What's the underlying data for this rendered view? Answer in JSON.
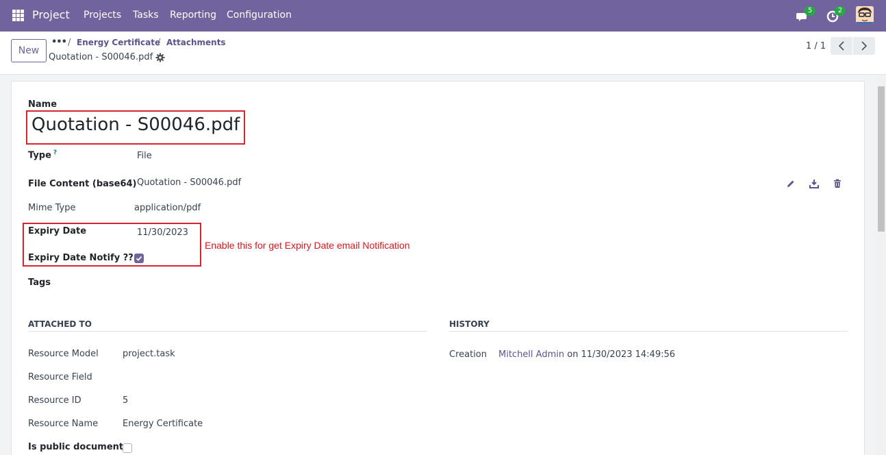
{
  "navbar": {
    "app_name": "Project",
    "menu": [
      "Projects",
      "Tasks",
      "Reporting",
      "Configuration"
    ],
    "messages_count": "5",
    "activities_count": "2",
    "bg_color": "#71639e"
  },
  "control_panel": {
    "new_label": "New",
    "breadcrumb": [
      "Energy Certificate",
      "Attachments"
    ],
    "record_title": "Quotation - S00046.pdf",
    "pager": "1 / 1"
  },
  "form": {
    "name_label": "Name",
    "name_value": "Quotation - S00046.pdf",
    "type_label": "Type",
    "type_help": "?",
    "type_value": "File",
    "file_content_label": "File Content (base64)",
    "file_content_value": "Quotation - S00046.pdf",
    "mime_label": "Mime Type",
    "mime_value": "application/pdf",
    "expiry_label": "Expiry Date",
    "expiry_value": "11/30/2023",
    "expiry_notify_label": "Expiry Date Notify ??",
    "expiry_notify_checked": true,
    "tags_label": "Tags",
    "annotation": "Enable this for get Expiry Date email Notification"
  },
  "attached_to": {
    "title": "ATTACHED TO",
    "resource_model_label": "Resource Model",
    "resource_model_value": "project.task",
    "resource_field_label": "Resource Field",
    "resource_id_label": "Resource ID",
    "resource_id_value": "5",
    "resource_name_label": "Resource Name",
    "resource_name_value": "Energy Certificate",
    "public_label": "Is public document",
    "public_checked": false
  },
  "history": {
    "title": "HISTORY",
    "creation_label": "Creation",
    "creation_user": "Mitchell Admin",
    "creation_rest": "on 11/30/2023 14:49:56"
  }
}
